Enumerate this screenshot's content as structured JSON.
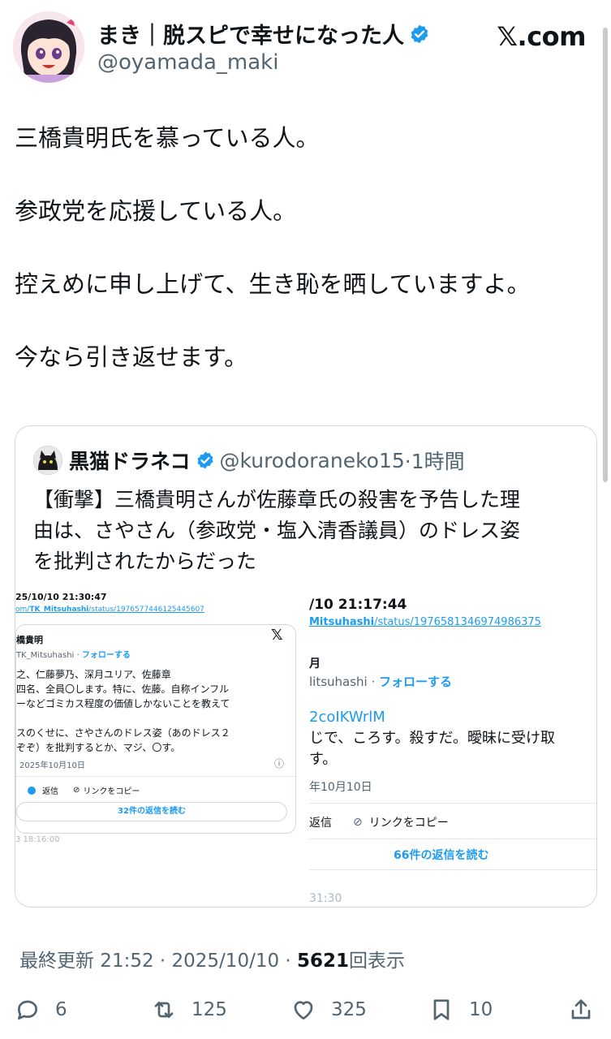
{
  "header": {
    "display_name": "まき｜脱スピで幸せになった人",
    "handle": "@oyamada_maki",
    "site": "𝕏.com"
  },
  "tweet": {
    "lines": [
      "三橋貴明氏を慕っている人。",
      "参政党を応援している人。",
      "控えめに申し上げて、生き恥を晒していますよ。",
      "今なら引き返せます。"
    ]
  },
  "quote": {
    "name": "黒猫ドラネコ",
    "handle": "@kurodoraneko15",
    "time": "·1時間",
    "text_lines": [
      "【衝撃】三橋貴明さんが佐藤章氏の殺害を予告した理",
      "由は、さやさん（参政党・塩入清香議員）のドレス姿",
      "を批判されたからだった"
    ],
    "left_shot": {
      "timestamp": "25/10/10 21:30:47",
      "url_pre": "om/",
      "url_user": "TK_Mitsuhashi",
      "url_rest": "/status/1976577446125445607",
      "name": "橋貴明",
      "handle": "TK_Mitsuhashi · ",
      "follow": "フォローする",
      "close": "𝕏",
      "body": [
        "之、仁藤夢乃、深月ユリア、佐藤章",
        "四名、全員〇します。特に、佐藤。自称インフル",
        "ーなどゴミカス程度の価値しかないことを教えて",
        "",
        "スのくせに、さやさんのドレス姿（あのドレス２",
        "ぞぞ）を批判するとか、マジ、〇す。"
      ],
      "date": "2025年10月10日",
      "info": "ⓘ",
      "reply": "返信",
      "copy": "リンクをコピー",
      "read": "32件の返信を読む",
      "footer": "3 18:16:00"
    },
    "right_shot": {
      "timestamp": "/10 21:17:44",
      "url_user": "Mitsuhashi",
      "url_rest": "/status/1976581346974986375",
      "name": "月",
      "handle": "litsuhashi · ",
      "follow": "フォローする",
      "link": "2coIKWrlM",
      "body": [
        "じで、ころす。殺すだ。曖昧に受け取",
        "す。"
      ],
      "date": "年10月10日",
      "reply": "返信",
      "copy": "リンクをコピー",
      "read": "66件の返信を読む",
      "footer": "31:30"
    }
  },
  "meta": {
    "updated": "最終更新 21:52 · 2025/10/10 ·",
    "views_count": "5621",
    "views_label": "回表示"
  },
  "actions": {
    "replies": "6",
    "reposts": "125",
    "likes": "325",
    "bookmarks": "10"
  },
  "colors": {
    "text": "#0f1419",
    "muted": "#536471",
    "accent": "#1d9bf0",
    "border": "#cfd9de"
  }
}
